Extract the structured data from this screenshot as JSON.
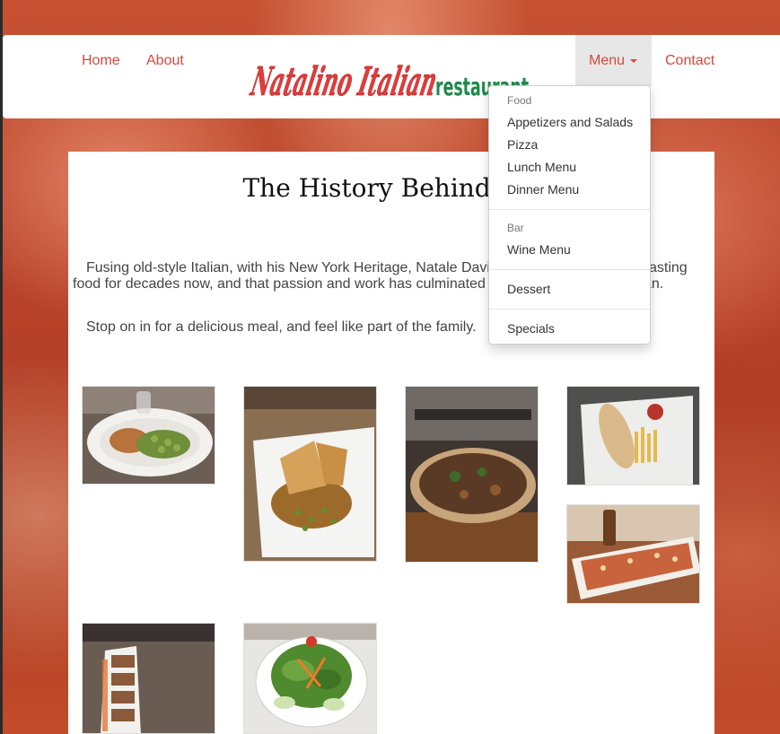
{
  "nav": {
    "home": "Home",
    "about": "About",
    "menu": "Menu",
    "contact": "Contact",
    "logo": {
      "script_text": "Natalino Italian",
      "word_text": "restaurant",
      "script_color": "#e23b3b",
      "word_color": "#1f8a4c"
    }
  },
  "dropdown": {
    "food_header": "Food",
    "food_items": [
      "Appetizers and Salads",
      "Pizza",
      "Lunch Menu",
      "Dinner Menu"
    ],
    "bar_header": "Bar",
    "bar_items": [
      "Wine Menu"
    ],
    "dessert": "Dessert",
    "specials": "Specials"
  },
  "content": {
    "title": "The History Behind the",
    "para1_line1": "Fusing old-style Italian, with his New York Heritage, Natale Davi",
    "para1_line1_end": "asting",
    "para1_line2": "food for decades now, and that passion and work has culminated",
    "para1_line2_end": "an.",
    "para2": "Stop on in for a delicious meal, and feel like part of the family."
  },
  "colors": {
    "accent": "#d9473a",
    "text": "#444444",
    "dropdown_text": "#333333",
    "dropdown_header": "#777777"
  },
  "gallery": [
    {
      "name": "photo-chicken-gnocchi",
      "subject": "chicken with green gnocchi plate"
    },
    {
      "name": "photo-sandwich-gravy",
      "subject": "grilled sandwich with gravy and peas"
    },
    {
      "name": "photo-pizza",
      "subject": "flatbread pizza with mushrooms"
    },
    {
      "name": "photo-sub-fries",
      "subject": "sub sandwich with fries"
    },
    {
      "name": "photo-bruschetta",
      "subject": "bruschetta platter with beer"
    },
    {
      "name": "photo-salmon-appetizer",
      "subject": "appetizer slices on long plate"
    },
    {
      "name": "photo-salad",
      "subject": "green salad with carrots and cucumber"
    }
  ]
}
